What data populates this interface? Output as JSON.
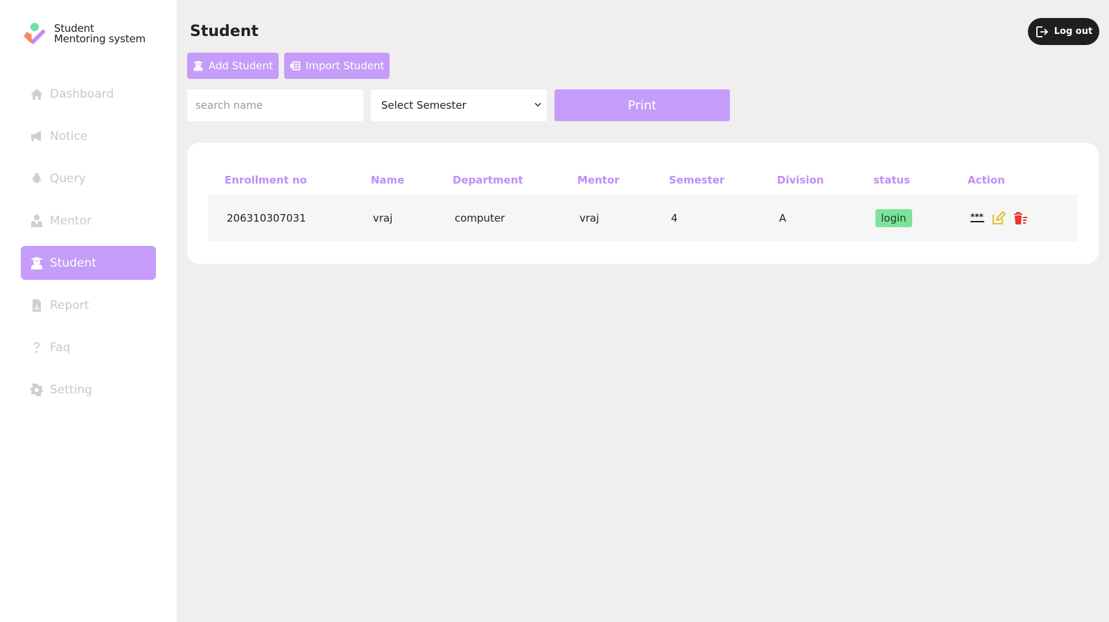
{
  "app": {
    "logo_line1": "Student",
    "logo_line2": "Mentoring system"
  },
  "sidebar": {
    "items": [
      {
        "label": "Dashboard",
        "icon": "home-icon"
      },
      {
        "label": "Notice",
        "icon": "megaphone-icon"
      },
      {
        "label": "Query",
        "icon": "bug-icon"
      },
      {
        "label": "Mentor",
        "icon": "user-tie-icon"
      },
      {
        "label": "Student",
        "icon": "graduate-icon",
        "active": true
      },
      {
        "label": "Report",
        "icon": "report-icon"
      },
      {
        "label": "Faq",
        "icon": "question-icon"
      },
      {
        "label": "Setting",
        "icon": "gear-icon"
      }
    ]
  },
  "header": {
    "title": "Student",
    "logout_label": "Log out"
  },
  "toolbar": {
    "add_label": "Add Student",
    "import_label": "Import Student"
  },
  "filters": {
    "search_placeholder": "search name",
    "semester_selected": "Select Semester",
    "print_label": "Print"
  },
  "table": {
    "columns": [
      "Enrollment no",
      "Name",
      "Department",
      "Mentor",
      "Semester",
      "Division",
      "status",
      "Action"
    ],
    "rows": [
      {
        "enrollment": "206310307031",
        "name": "vraj",
        "department": "computer",
        "mentor": "vraj",
        "semester": "4",
        "division": "A",
        "status": "login"
      }
    ]
  },
  "colors": {
    "accent": "#c59cf9",
    "header_text": "#c08ef7",
    "status_green": "#7de39b",
    "edit_yellow": "#e0b814",
    "delete_red": "#e53935"
  }
}
